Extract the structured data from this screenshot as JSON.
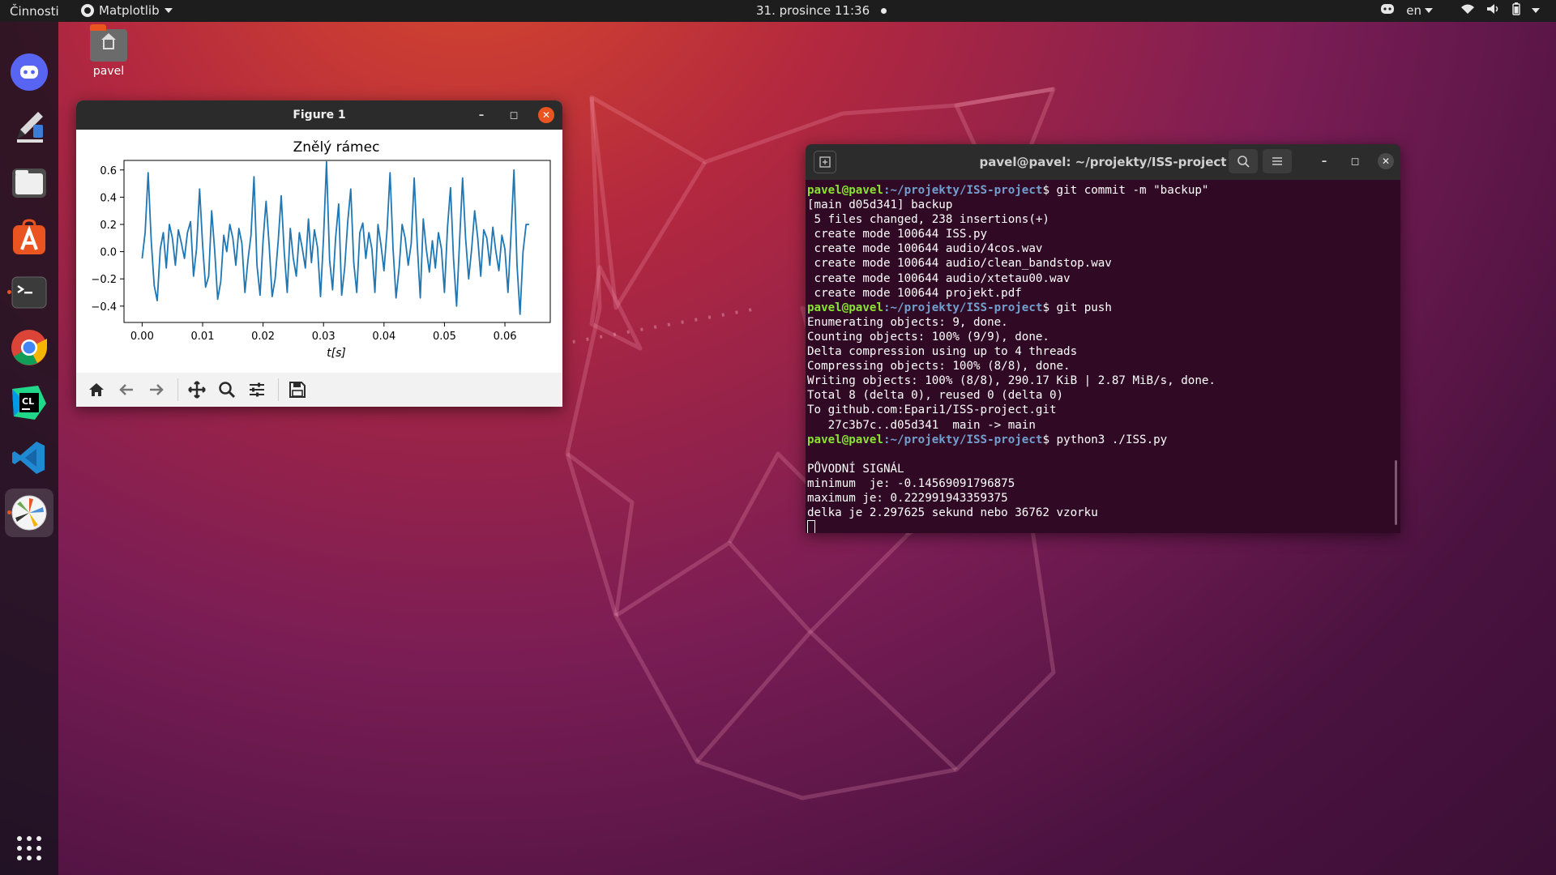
{
  "topbar": {
    "activities": "Činnosti",
    "app_name": "Matplotlib",
    "clock": "31. prosince  11:36",
    "language": "en"
  },
  "desktop": {
    "home_folder_label": "pavel"
  },
  "dock": {
    "items": [
      "discord-icon",
      "inkscape-icon",
      "files-icon",
      "software-center-icon",
      "terminal-icon",
      "chrome-icon",
      "clion-icon",
      "vscode-icon",
      "matplotlib-icon"
    ],
    "show_apps": "show-apps-icon"
  },
  "figure_window": {
    "title": "Figure 1",
    "toolbar": [
      "home-icon",
      "back-icon",
      "forward-icon",
      "pan-icon",
      "zoom-icon",
      "configure-subplots-icon",
      "save-icon"
    ]
  },
  "chart_data": {
    "type": "line",
    "title": "Znělý rámec",
    "xlabel": "t[s]",
    "ylabel": "",
    "xlim": [
      -0.003,
      0.0675
    ],
    "ylim": [
      -0.52,
      0.67
    ],
    "xticks": [
      "0.00",
      "0.01",
      "0.02",
      "0.03",
      "0.04",
      "0.05",
      "0.06"
    ],
    "xtick_values": [
      0.0,
      0.01,
      0.02,
      0.03,
      0.04,
      0.05,
      0.06
    ],
    "yticks": [
      "−0.4",
      "−0.2",
      "0.0",
      "0.2",
      "0.4",
      "0.6"
    ],
    "ytick_values": [
      -0.4,
      -0.2,
      0.0,
      0.2,
      0.4,
      0.6
    ],
    "grid": false,
    "line_color": "#1f77b4",
    "x": [
      0.0,
      0.0005,
      0.001,
      0.0015,
      0.002,
      0.0025,
      0.003,
      0.0035,
      0.004,
      0.0045,
      0.005,
      0.0055,
      0.006,
      0.0065,
      0.007,
      0.0075,
      0.008,
      0.0085,
      0.009,
      0.0095,
      0.01,
      0.0105,
      0.011,
      0.0115,
      0.012,
      0.0125,
      0.013,
      0.0135,
      0.014,
      0.0145,
      0.015,
      0.0155,
      0.016,
      0.0165,
      0.017,
      0.0175,
      0.018,
      0.0185,
      0.019,
      0.0195,
      0.02,
      0.0205,
      0.021,
      0.0215,
      0.022,
      0.0225,
      0.023,
      0.0235,
      0.024,
      0.0245,
      0.025,
      0.0255,
      0.026,
      0.0265,
      0.027,
      0.0275,
      0.028,
      0.0285,
      0.029,
      0.0295,
      0.03,
      0.0305,
      0.031,
      0.0315,
      0.032,
      0.0325,
      0.033,
      0.0335,
      0.034,
      0.0345,
      0.035,
      0.0355,
      0.036,
      0.0365,
      0.037,
      0.0375,
      0.038,
      0.0385,
      0.039,
      0.0395,
      0.04,
      0.0405,
      0.041,
      0.0415,
      0.042,
      0.0425,
      0.043,
      0.0435,
      0.044,
      0.0445,
      0.045,
      0.0455,
      0.046,
      0.0465,
      0.047,
      0.0475,
      0.048,
      0.0485,
      0.049,
      0.0495,
      0.05,
      0.0505,
      0.051,
      0.0515,
      0.052,
      0.0525,
      0.053,
      0.0535,
      0.054,
      0.0545,
      0.055,
      0.0555,
      0.056,
      0.0565,
      0.057,
      0.0575,
      0.058,
      0.0585,
      0.059,
      0.0595,
      0.06,
      0.0605,
      0.061,
      0.0615,
      0.062,
      0.0625,
      0.063,
      0.0635,
      0.064
    ],
    "y": [
      -0.05,
      0.14,
      0.58,
      0.08,
      -0.25,
      -0.36,
      0.02,
      0.14,
      -0.12,
      0.2,
      0.1,
      -0.1,
      0.16,
      0.06,
      -0.05,
      0.14,
      0.22,
      -0.18,
      0.02,
      0.46,
      0.05,
      -0.26,
      -0.18,
      0.3,
      0.01,
      -0.35,
      -0.22,
      0.12,
      0.0,
      0.2,
      0.1,
      -0.1,
      0.17,
      0.06,
      -0.3,
      -0.06,
      0.12,
      0.55,
      -0.1,
      -0.32,
      0.08,
      0.37,
      0.05,
      -0.33,
      -0.2,
      0.08,
      0.41,
      0.0,
      -0.3,
      0.17,
      -0.05,
      -0.18,
      0.14,
      0.02,
      -0.12,
      0.24,
      -0.08,
      0.16,
      0.03,
      -0.33,
      0.1,
      0.66,
      -0.06,
      -0.28,
      0.1,
      0.35,
      -0.32,
      -0.12,
      0.22,
      0.46,
      -0.08,
      -0.3,
      0.14,
      0.21,
      -0.05,
      0.14,
      0.02,
      -0.3,
      0.2,
      0.05,
      -0.14,
      0.16,
      0.58,
      0.02,
      -0.34,
      -0.12,
      0.2,
      0.1,
      -0.1,
      0.06,
      0.54,
      0.05,
      -0.34,
      0.24,
      0.02,
      -0.15,
      0.08,
      -0.12,
      0.14,
      0.02,
      -0.3,
      0.18,
      0.47,
      -0.05,
      -0.4,
      0.08,
      0.54,
      0.1,
      -0.2,
      0.02,
      0.3,
      0.1,
      -0.18,
      0.16,
      0.1,
      -0.1,
      0.18,
      0.0,
      -0.14,
      0.12,
      0.02,
      -0.3,
      0.12,
      0.6,
      -0.1,
      -0.46,
      0.0,
      0.2,
      0.2
    ]
  },
  "terminal": {
    "title": "pavel@pavel: ~/projekty/ISS-project",
    "prompt_user": "pavel@pavel",
    "prompt_path": ":~/projekty/ISS-project",
    "prompt_sign": "$ ",
    "cmd1": "git commit -m \"backup\"",
    "out1": "[main d05d341] backup\n 5 files changed, 238 insertions(+)\n create mode 100644 ISS.py\n create mode 100644 audio/4cos.wav\n create mode 100644 audio/clean_bandstop.wav\n create mode 100644 audio/xtetau00.wav\n create mode 100644 projekt.pdf",
    "cmd2": "git push",
    "out2": "Enumerating objects: 9, done.\nCounting objects: 100% (9/9), done.\nDelta compression using up to 4 threads\nCompressing objects: 100% (8/8), done.\nWriting objects: 100% (8/8), 290.17 KiB | 2.87 MiB/s, done.\nTotal 8 (delta 0), reused 0 (delta 0)\nTo github.com:Epari1/ISS-project.git\n   27c3b7c..d05d341  main -> main",
    "cmd3": "python3 ./ISS.py",
    "out3": "\nPŮVODNÍ SIGNÁL\nminimum  je: -0.14569091796875\nmaximum je: 0.222991943359375\ndelka je 2.297625 sekund nebo 36762 vzorku"
  }
}
